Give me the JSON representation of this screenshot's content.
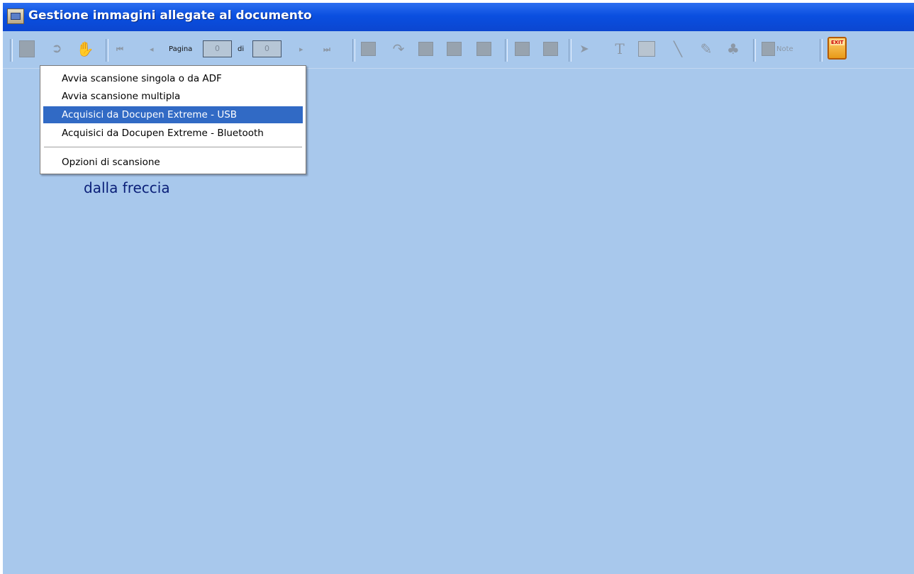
{
  "window": {
    "title": "Gestione immagini allegate al documento"
  },
  "toolbar": {
    "page_label": "Pagina",
    "page_value": "0",
    "of_label": "di",
    "total_value": "0",
    "note_label": "Note",
    "exit_label": "EXIT"
  },
  "menu": {
    "items": [
      "Avvia scansione singola o da ADF",
      "Avvia scansione multipla",
      "Acquisici da Docupen Extreme - USB",
      "Acquisici da Docupen Extreme - Bluetooth",
      "Opzioni di scansione"
    ],
    "selected_index": 2
  },
  "background": {
    "hint_text": "dalla freccia"
  },
  "colors": {
    "titlebar": "#0a4fe0",
    "workspace": "#a8c8ec",
    "menu_highlight": "#316ac5",
    "hint_text": "#0a1f78"
  }
}
